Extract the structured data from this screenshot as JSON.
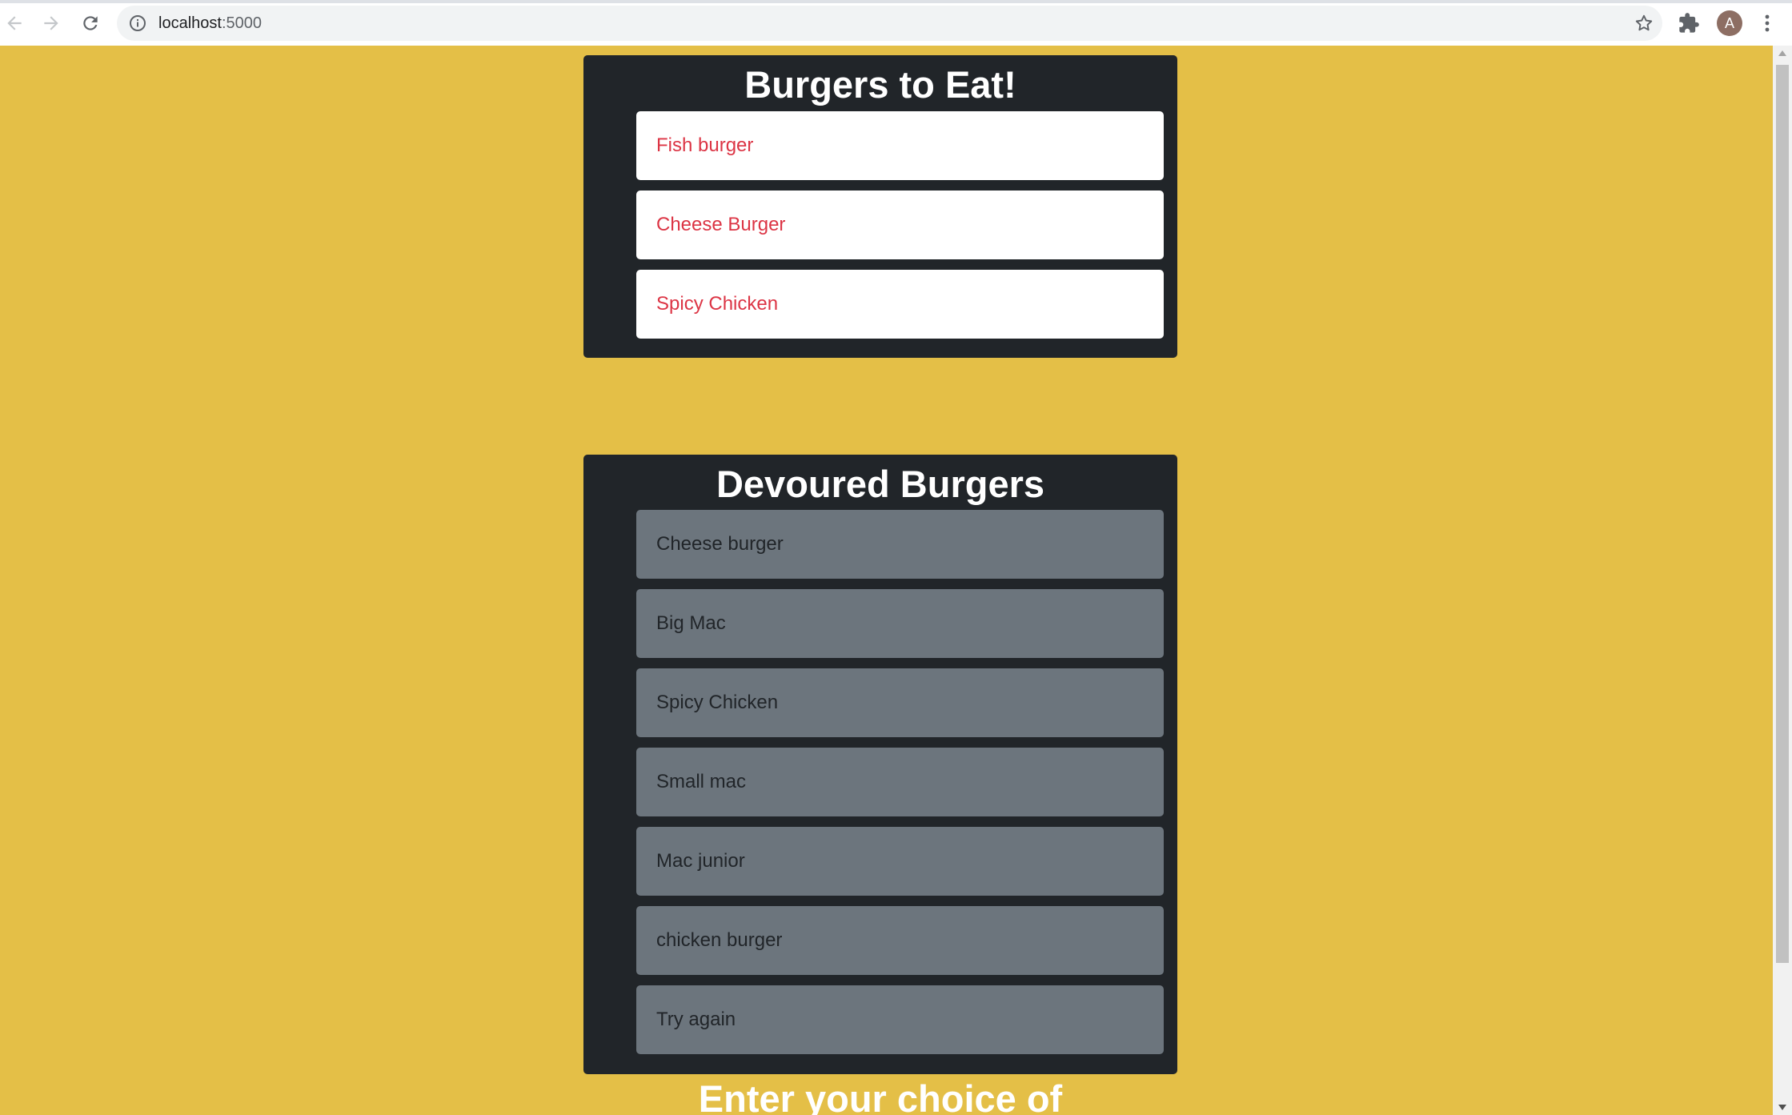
{
  "browser": {
    "url_host": "localhost",
    "url_port": ":5000",
    "profile_initial": "A"
  },
  "to_eat": {
    "title": "Burgers to Eat!",
    "items": [
      "Fish burger",
      "Cheese Burger",
      "Spicy Chicken"
    ]
  },
  "devoured": {
    "title": "Devoured Burgers",
    "items": [
      "Cheese burger",
      "Big Mac",
      "Spicy Chicken",
      "Small mac",
      "Mac junior",
      "chicken burger",
      "Try again"
    ]
  },
  "form": {
    "heading": "Enter your choice of"
  },
  "colors": {
    "page_background": "#e4bf47",
    "panel_background": "#212529",
    "todo_text": "#dc3545",
    "done_background": "#6c757d"
  }
}
